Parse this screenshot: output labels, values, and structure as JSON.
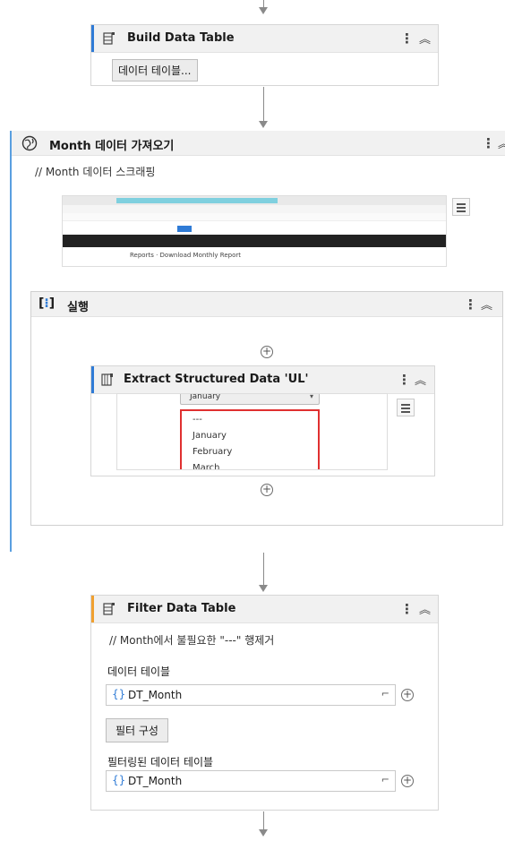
{
  "build_table": {
    "title": "Build Data Table",
    "button_label": "데이터 테이블..."
  },
  "month_seq": {
    "title": "Month 데이터 가져오기",
    "comment": "// Month 데이터 스크래핑",
    "screenshot_caption": "Reports · Download Monthly Report"
  },
  "do_seq": {
    "title": "실행"
  },
  "extract": {
    "title": "Extract Structured Data 'UL'",
    "dropdown_selected": "January",
    "list_items": [
      "---",
      "January",
      "February",
      "March"
    ]
  },
  "filter": {
    "title": "Filter Data Table",
    "comment": "// Month에서 불필요한 \"---\" 행제거",
    "input_label": "데이터 테이블",
    "input_value": "DT_Month",
    "config_button": "필터 구성",
    "output_label": "필터링된 데이터 테이블",
    "output_value": "DT_Month"
  },
  "icons": {
    "brace": "{}",
    "kebab": "⋮",
    "collapse": "≈"
  },
  "colors": {
    "accent": "#2f7bd6",
    "sequence_accent": "#5a9fe0",
    "highlight": "#e03030"
  }
}
